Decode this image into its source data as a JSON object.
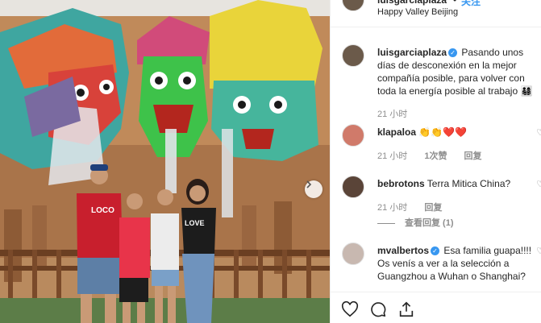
{
  "post": {
    "username": "luisgarciaplaza",
    "follow_dot": "•",
    "follow_label": "关注",
    "location": "Happy Valley Beijing",
    "photo_text": "LOCO",
    "photo_shirt_text": "LOVE"
  },
  "caption": {
    "username": "luisgarciaplaza",
    "text": " Pasando unos días de desconexión en la mejor compañía posible, para volver con toda la energía posible al trabajo 👨‍👩‍👧‍👦",
    "time": "21 小时"
  },
  "comments": [
    {
      "username": "klapaloa",
      "text": " 👏👏❤️❤️",
      "time": "21 小时",
      "likes": "1次赞",
      "reply": "回复"
    },
    {
      "username": "bebrotons",
      "text": " Terra Mitica China?",
      "time": "21 小时",
      "reply": "回复",
      "view_replies": "查看回复 (1)"
    },
    {
      "username": "mvalbertos",
      "text": " Esa familia guapa!!!! Os venís a ver a la selección a Guangzhou a Wuhan o Shanghai?"
    }
  ],
  "icons": {
    "verified": "✓",
    "like": "heart-icon",
    "comment": "comment-icon",
    "share": "share-icon",
    "small_like": "♡",
    "next": "chevron-right-icon"
  },
  "colors": {
    "link_blue": "#3897f0",
    "meta_gray": "#8e8e8e",
    "border": "#efefef"
  }
}
